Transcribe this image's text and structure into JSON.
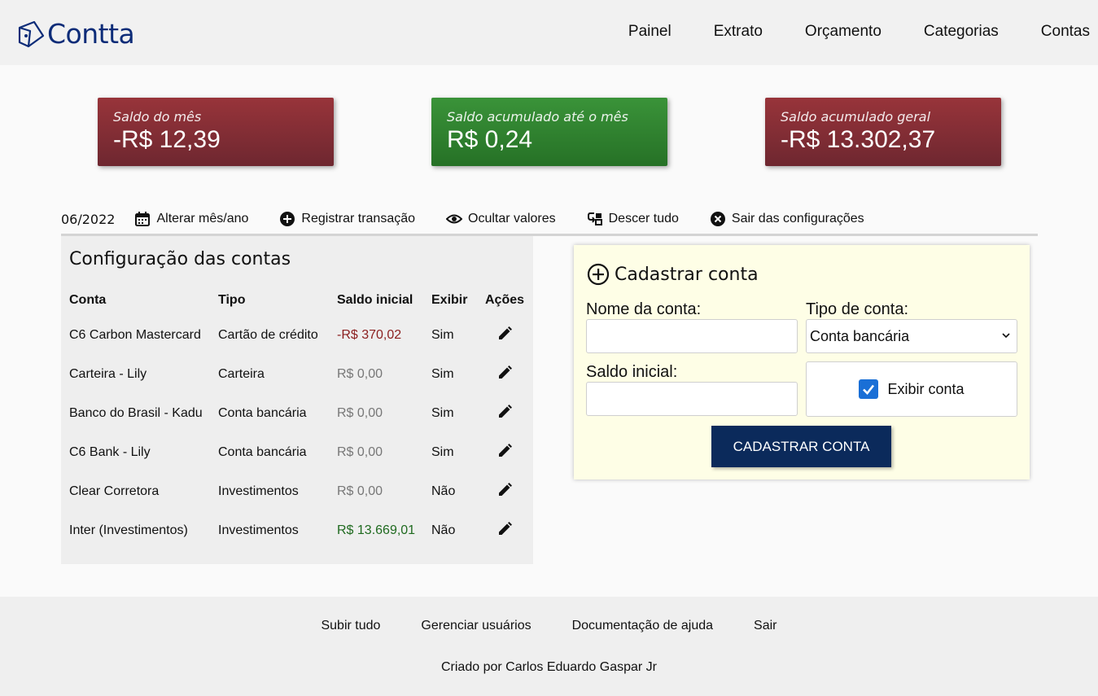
{
  "app": {
    "name": "Contta"
  },
  "nav": [
    "Painel",
    "Extrato",
    "Orçamento",
    "Categorias",
    "Contas"
  ],
  "cards": [
    {
      "label": "Saldo do mês",
      "value": "-R$ 12,39",
      "color": "#98343a"
    },
    {
      "label": "Saldo acumulado até o mês",
      "value": "R$ 0,24",
      "color": "#3a9339"
    },
    {
      "label": "Saldo acumulado geral",
      "value": "-R$ 13.302,37",
      "color": "#98343a"
    }
  ],
  "toolbar": {
    "period": "06/2022",
    "change_period": "Alterar mês/ano",
    "register": "Registrar transação",
    "hide_values": "Ocultar valores",
    "scroll_down": "Descer tudo",
    "exit_settings": "Sair das configurações"
  },
  "accounts": {
    "title": "Configuração das contas",
    "headers": [
      "Conta",
      "Tipo",
      "Saldo inicial",
      "Exibir",
      "Ações"
    ],
    "rows": [
      {
        "name": "C6 Carbon Mastercard",
        "type": "Cartão de crédito",
        "balance": "-R$ 370,02",
        "show": "Sim"
      },
      {
        "name": "Carteira - Lily",
        "type": "Carteira",
        "balance": "R$ 0,00",
        "show": "Sim"
      },
      {
        "name": "Banco do Brasil - Kadu",
        "type": "Conta bancária",
        "balance": "R$ 0,00",
        "show": "Sim"
      },
      {
        "name": "C6 Bank - Lily",
        "type": "Conta bancária",
        "balance": "R$ 0,00",
        "show": "Sim"
      },
      {
        "name": "Clear Corretora",
        "type": "Investimentos",
        "balance": "R$ 0,00",
        "show": "Não"
      },
      {
        "name": "Inter (Investimentos)",
        "type": "Investimentos",
        "balance": "R$ 13.669,01",
        "show": "Não"
      }
    ]
  },
  "form": {
    "title": "Cadastrar conta",
    "name_label": "Nome da conta:",
    "name_value": "",
    "type_label": "Tipo de conta:",
    "type_value": "Conta bancária",
    "balance_label": "Saldo inicial:",
    "balance_value": "",
    "show_label": "Exibir conta",
    "submit": "CADASTRAR CONTA"
  },
  "footer": {
    "links": [
      "Subir tudo",
      "Gerenciar usuários",
      "Documentação de ajuda",
      "Sair"
    ],
    "credit": "Criado por Carlos Eduardo Gaspar Jr"
  }
}
